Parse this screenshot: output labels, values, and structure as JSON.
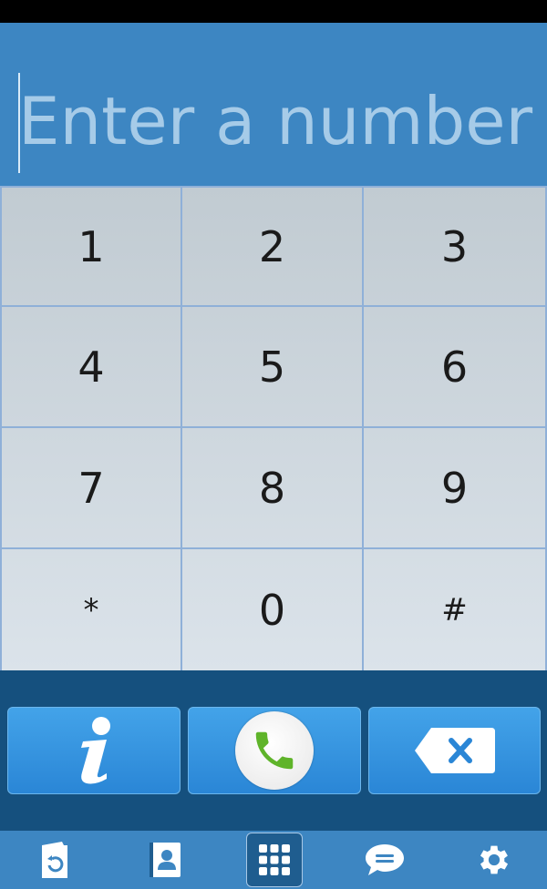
{
  "dialer": {
    "placeholder": "Enter a number",
    "value": ""
  },
  "keypad": {
    "keys": [
      "1",
      "2",
      "3",
      "4",
      "5",
      "6",
      "7",
      "8",
      "9",
      "*",
      "0",
      "#"
    ]
  },
  "actions": {
    "info_icon": "info-icon",
    "call_icon": "phone-icon",
    "backspace_icon": "backspace-icon"
  },
  "nav": {
    "items": [
      "recents-icon",
      "contacts-icon",
      "dialpad-icon",
      "messages-icon",
      "settings-icon"
    ],
    "active": "dialpad"
  },
  "colors": {
    "header_bg": "#3d86c2",
    "action_bar_bg": "#15507e",
    "button_blue": "#2a86d6",
    "call_green": "#5fb42a"
  }
}
